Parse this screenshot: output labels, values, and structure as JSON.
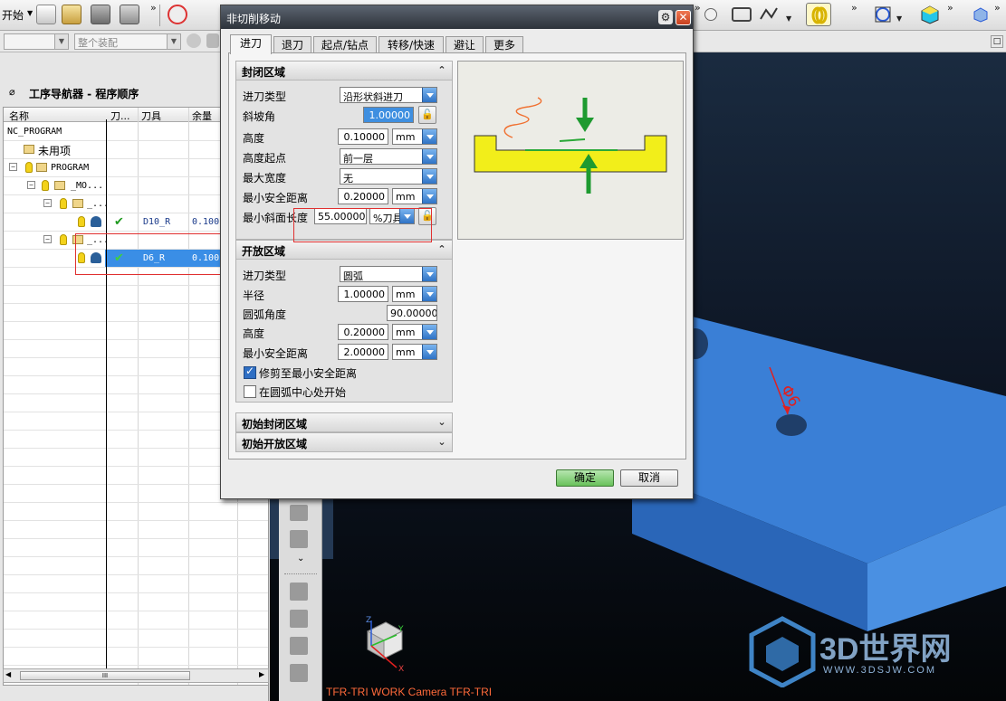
{
  "toolbar": {
    "start_label": "开始",
    "assembly_combo": "整个装配"
  },
  "navigator": {
    "title": "工序导航器 - 程序顺序",
    "columns": [
      "名称",
      "刀...",
      "刀具",
      "余量"
    ],
    "rows": [
      {
        "name": "NC_PROGRAM",
        "tool": "",
        "stock": ""
      },
      {
        "name": "未用项",
        "tool": "",
        "stock": ""
      },
      {
        "name": "PROGRAM",
        "tool": "",
        "stock": ""
      },
      {
        "name": "_MO...",
        "tool": "",
        "stock": ""
      },
      {
        "name": "_...",
        "tool": "",
        "stock": ""
      },
      {
        "name": "",
        "tool": "D10_R",
        "stock": "0.100("
      },
      {
        "name": "_...",
        "tool": "",
        "stock": ""
      },
      {
        "name": "",
        "tool": "D6_R",
        "stock": "0.100("
      }
    ],
    "scroll_grip": "III"
  },
  "dialog": {
    "title": "非切削移动",
    "tabs": [
      "进刀",
      "退刀",
      "起点/钻点",
      "转移/快速",
      "避让",
      "更多"
    ],
    "closed_area": {
      "header": "封闭区域",
      "engage_type_label": "进刀类型",
      "engage_type_value": "沿形状斜进刀",
      "ramp_angle_label": "斜坡角",
      "ramp_angle_value": "1.00000",
      "height_label": "高度",
      "height_value": "0.10000",
      "height_unit": "mm",
      "height_from_label": "高度起点",
      "height_from_value": "前一层",
      "max_width_label": "最大宽度",
      "max_width_value": "无",
      "min_clearance_label": "最小安全距离",
      "min_clearance_value": "0.20000",
      "min_clearance_unit": "mm",
      "min_ramp_length_label": "最小斜面长度",
      "min_ramp_length_value": "55.00000",
      "min_ramp_length_unit": "%刀具"
    },
    "open_area": {
      "header": "开放区域",
      "engage_type_label": "进刀类型",
      "engage_type_value": "圆弧",
      "radius_label": "半径",
      "radius_value": "1.00000",
      "radius_unit": "mm",
      "arc_angle_label": "圆弧角度",
      "arc_angle_value": "90.00000",
      "height_label": "高度",
      "height_value": "0.20000",
      "height_unit": "mm",
      "min_clearance_label": "最小安全距离",
      "min_clearance_value": "2.00000",
      "min_clearance_unit": "mm",
      "trim_label": "修剪至最小安全距离",
      "trim_checked": true,
      "arc_center_label": "在圆弧中心处开始",
      "arc_center_checked": false
    },
    "initial_closed_header": "初始封闭区域",
    "initial_open_header": "初始开放区域",
    "ok_label": "确定",
    "cancel_label": "取消"
  },
  "viewport": {
    "camera_label": "TFR-TRI WORK Camera TFR-TRI",
    "dimension_label": "Φ6",
    "triad_x": "X",
    "triad_y": "Y",
    "triad_z": "Z",
    "watermark": "3D世界网",
    "watermark_url": "WWW.3DSJW.COM"
  },
  "colors": {
    "part": "#3a7fd6",
    "ok_button": "#69c25a",
    "selection": "#3a8ee6",
    "annotation_box": "#e03030"
  }
}
